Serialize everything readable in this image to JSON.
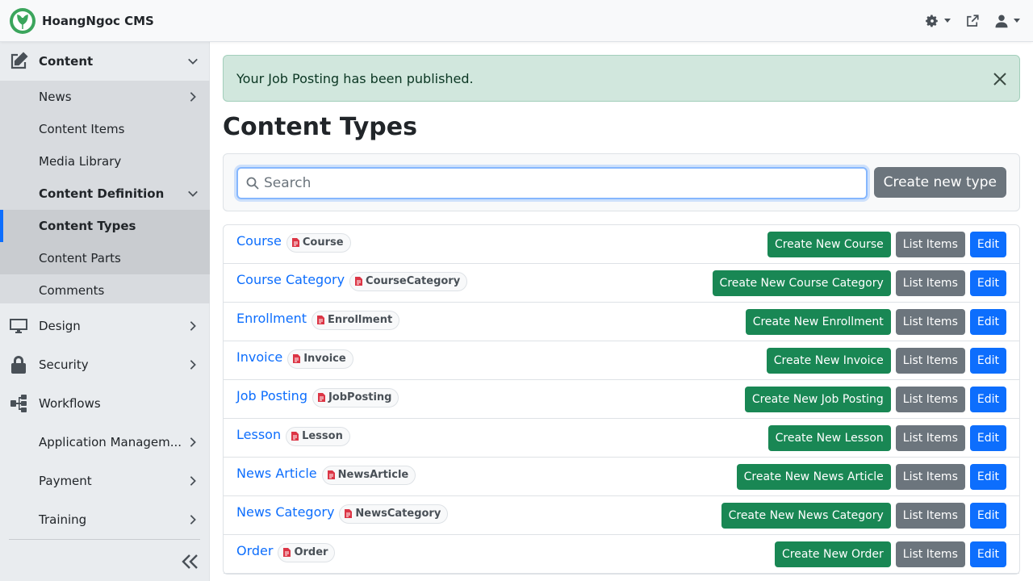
{
  "app": {
    "title": "HoangNgoc CMS",
    "brand_color": "#3ba55c"
  },
  "header": {
    "icons": [
      "theme-gear-icon",
      "external-link-icon",
      "user-icon"
    ]
  },
  "sidebar": {
    "items": [
      {
        "label": "Content",
        "icon": "edit-icon",
        "expanded": true
      },
      {
        "label": "News"
      },
      {
        "label": "Content Items"
      },
      {
        "label": "Media Library"
      },
      {
        "label": "Content Definition",
        "expanded": true
      },
      {
        "label": "Content Types",
        "active": true
      },
      {
        "label": "Content Parts"
      },
      {
        "label": "Comments"
      },
      {
        "label": "Design",
        "icon": "monitor-icon"
      },
      {
        "label": "Security",
        "icon": "lock-icon"
      },
      {
        "label": "Workflows",
        "icon": "workflow-icon"
      },
      {
        "label": "Application Managem..."
      },
      {
        "label": "Payment"
      },
      {
        "label": "Training"
      }
    ]
  },
  "alert": {
    "message": "Your Job Posting has been published."
  },
  "main": {
    "title": "Content Types",
    "search": {
      "placeholder": "Search",
      "value": ""
    },
    "create_type_label": "Create new type",
    "list_items_label": "List Items",
    "edit_label": "Edit",
    "rows": [
      {
        "name": "Course",
        "technical": "Course",
        "create_label": "Create New Course"
      },
      {
        "name": "Course Category",
        "technical": "CourseCategory",
        "create_label": "Create New Course Category"
      },
      {
        "name": "Enrollment",
        "technical": "Enrollment",
        "create_label": "Create New Enrollment"
      },
      {
        "name": "Invoice",
        "technical": "Invoice",
        "create_label": "Create New Invoice"
      },
      {
        "name": "Job Posting",
        "technical": "JobPosting",
        "create_label": "Create New Job Posting"
      },
      {
        "name": "Lesson",
        "technical": "Lesson",
        "create_label": "Create New Lesson"
      },
      {
        "name": "News Article",
        "technical": "NewsArticle",
        "create_label": "Create New News Article"
      },
      {
        "name": "News Category",
        "technical": "NewsCategory",
        "create_label": "Create New News Category"
      },
      {
        "name": "Order",
        "technical": "Order",
        "create_label": "Create New Order"
      }
    ]
  }
}
